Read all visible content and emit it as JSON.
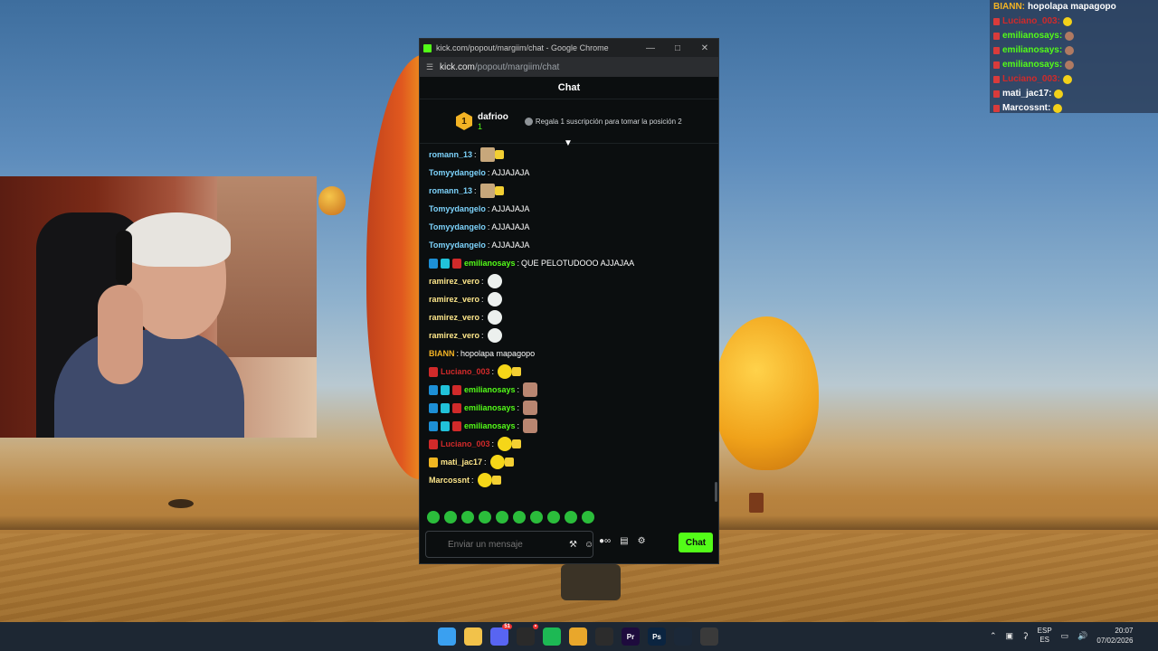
{
  "overlay": {
    "lines": [
      {
        "user": "BIANN",
        "text": "hopolapa mapagopo",
        "user_color": "#f3b324"
      },
      {
        "user": "Luciano_003",
        "text": "",
        "user_color": "#d12a2a"
      },
      {
        "user": "emilianosays",
        "text": "",
        "user_color": "#53fc18"
      },
      {
        "user": "emilianosays",
        "text": "",
        "user_color": "#53fc18"
      },
      {
        "user": "emilianosays",
        "text": "",
        "user_color": "#53fc18"
      },
      {
        "user": "Luciano_003",
        "text": "",
        "user_color": "#d12a2a"
      },
      {
        "user": "mati_jac17",
        "text": "",
        "user_color": "#ffffff"
      },
      {
        "user": "Marcossnt",
        "text": "",
        "user_color": "#ffffff"
      }
    ]
  },
  "browser": {
    "title": "kick.com/popout/margiim/chat - Google Chrome",
    "url_domain": "kick.com",
    "url_path": "/popout/margiim/chat"
  },
  "chat": {
    "header": "Chat",
    "gift": {
      "rank": "1",
      "gifter": "dafrioo",
      "count": "1",
      "message": "Regala 1 suscripción para tomar la posición 2"
    },
    "messages": [
      {
        "user": "romann_13",
        "color": "#7dd3fc",
        "text": "",
        "emote": "cat"
      },
      {
        "user": "Tomyydangelo",
        "color": "#7dd3fc",
        "text": "AJJAJAJA",
        "emote": ""
      },
      {
        "user": "romann_13",
        "color": "#7dd3fc",
        "text": "",
        "emote": "cat"
      },
      {
        "user": "Tomyydangelo",
        "color": "#7dd3fc",
        "text": "AJJAJAJA",
        "emote": ""
      },
      {
        "user": "Tomyydangelo",
        "color": "#7dd3fc",
        "text": "AJJAJAJA",
        "emote": ""
      },
      {
        "user": "Tomyydangelo",
        "color": "#7dd3fc",
        "text": "AJJAJAJA",
        "emote": ""
      },
      {
        "user": "emilianosays",
        "color": "#53fc18",
        "text": "QUE PELOTUDOOO AJJAJAA",
        "emote": "",
        "badges": [
          "blue",
          "cyan",
          "red"
        ]
      },
      {
        "user": "ramirez_vero",
        "color": "#fde68a",
        "text": "",
        "emote": "ghost"
      },
      {
        "user": "ramirez_vero",
        "color": "#fde68a",
        "text": "",
        "emote": "ghost"
      },
      {
        "user": "ramirez_vero",
        "color": "#fde68a",
        "text": "",
        "emote": "ghost"
      },
      {
        "user": "ramirez_vero",
        "color": "#fde68a",
        "text": "",
        "emote": "ghost"
      },
      {
        "user": "BIANN",
        "color": "#f3b324",
        "text": "hopolapa mapagopo",
        "emote": ""
      },
      {
        "user": "Luciano_003",
        "color": "#d12a2a",
        "text": "",
        "emote": "lol",
        "badges": [
          "red"
        ]
      },
      {
        "user": "emilianosays",
        "color": "#53fc18",
        "text": "",
        "emote": "face",
        "badges": [
          "blue",
          "cyan",
          "red"
        ]
      },
      {
        "user": "emilianosays",
        "color": "#53fc18",
        "text": "",
        "emote": "face",
        "badges": [
          "blue",
          "cyan",
          "red"
        ]
      },
      {
        "user": "emilianosays",
        "color": "#53fc18",
        "text": "",
        "emote": "face",
        "badges": [
          "blue",
          "cyan",
          "red"
        ]
      },
      {
        "user": "Luciano_003",
        "color": "#d12a2a",
        "text": "",
        "emote": "lol",
        "badges": [
          "red"
        ]
      },
      {
        "user": "mati_jac17",
        "color": "#fde68a",
        "text": "",
        "emote": "lol",
        "badges": [
          "gold"
        ]
      },
      {
        "user": "Marcossnt",
        "color": "#fde68a",
        "text": "",
        "emote": "lol"
      }
    ],
    "input_placeholder": "Enviar un mensaje",
    "send_label": "Chat",
    "accent": "#53fc18"
  },
  "taskbar": {
    "apps": [
      {
        "name": "windows-start-icon",
        "label": "",
        "color": "#3aa0f0"
      },
      {
        "name": "file-explorer-icon",
        "label": "",
        "color": "#f2c24a"
      },
      {
        "name": "discord-icon",
        "label": "",
        "color": "#5865f2",
        "badge": "51"
      },
      {
        "name": "obs-icon",
        "label": "",
        "color": "#2a2a2a",
        "badge": "•"
      },
      {
        "name": "spotify-icon",
        "label": "",
        "color": "#1db954"
      },
      {
        "name": "chrome-icon",
        "label": "",
        "color": "#e9a72b"
      },
      {
        "name": "app-icon",
        "label": "",
        "color": "#2c2c2c"
      },
      {
        "name": "premiere-icon",
        "label": "Pr",
        "color": "#1e0b3d"
      },
      {
        "name": "photoshop-icon",
        "label": "Ps",
        "color": "#0b2440"
      },
      {
        "name": "steam-icon",
        "label": "",
        "color": "#1b2838"
      },
      {
        "name": "app-icon-2",
        "label": "",
        "color": "#3a3a3a"
      }
    ],
    "language": "ESP",
    "language_sub": "ES",
    "time": "20:07",
    "date": "07/02/2026"
  }
}
